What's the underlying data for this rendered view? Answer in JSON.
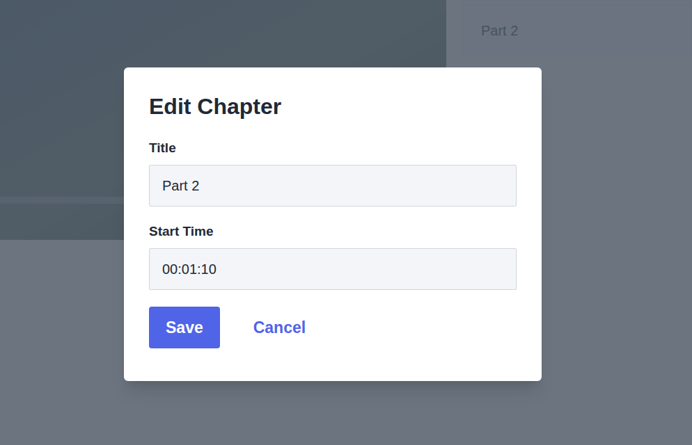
{
  "page": {
    "chapters": [
      {
        "title": "Part 2"
      }
    ]
  },
  "dialog": {
    "title": "Edit Chapter",
    "fields": [
      {
        "label": "Title",
        "value": "Part 2"
      },
      {
        "label": "Start Time",
        "value": "00:01:10"
      }
    ],
    "buttons": [
      {
        "label": "Save",
        "kind": "primary"
      },
      {
        "label": "Cancel",
        "kind": "link"
      }
    ]
  }
}
